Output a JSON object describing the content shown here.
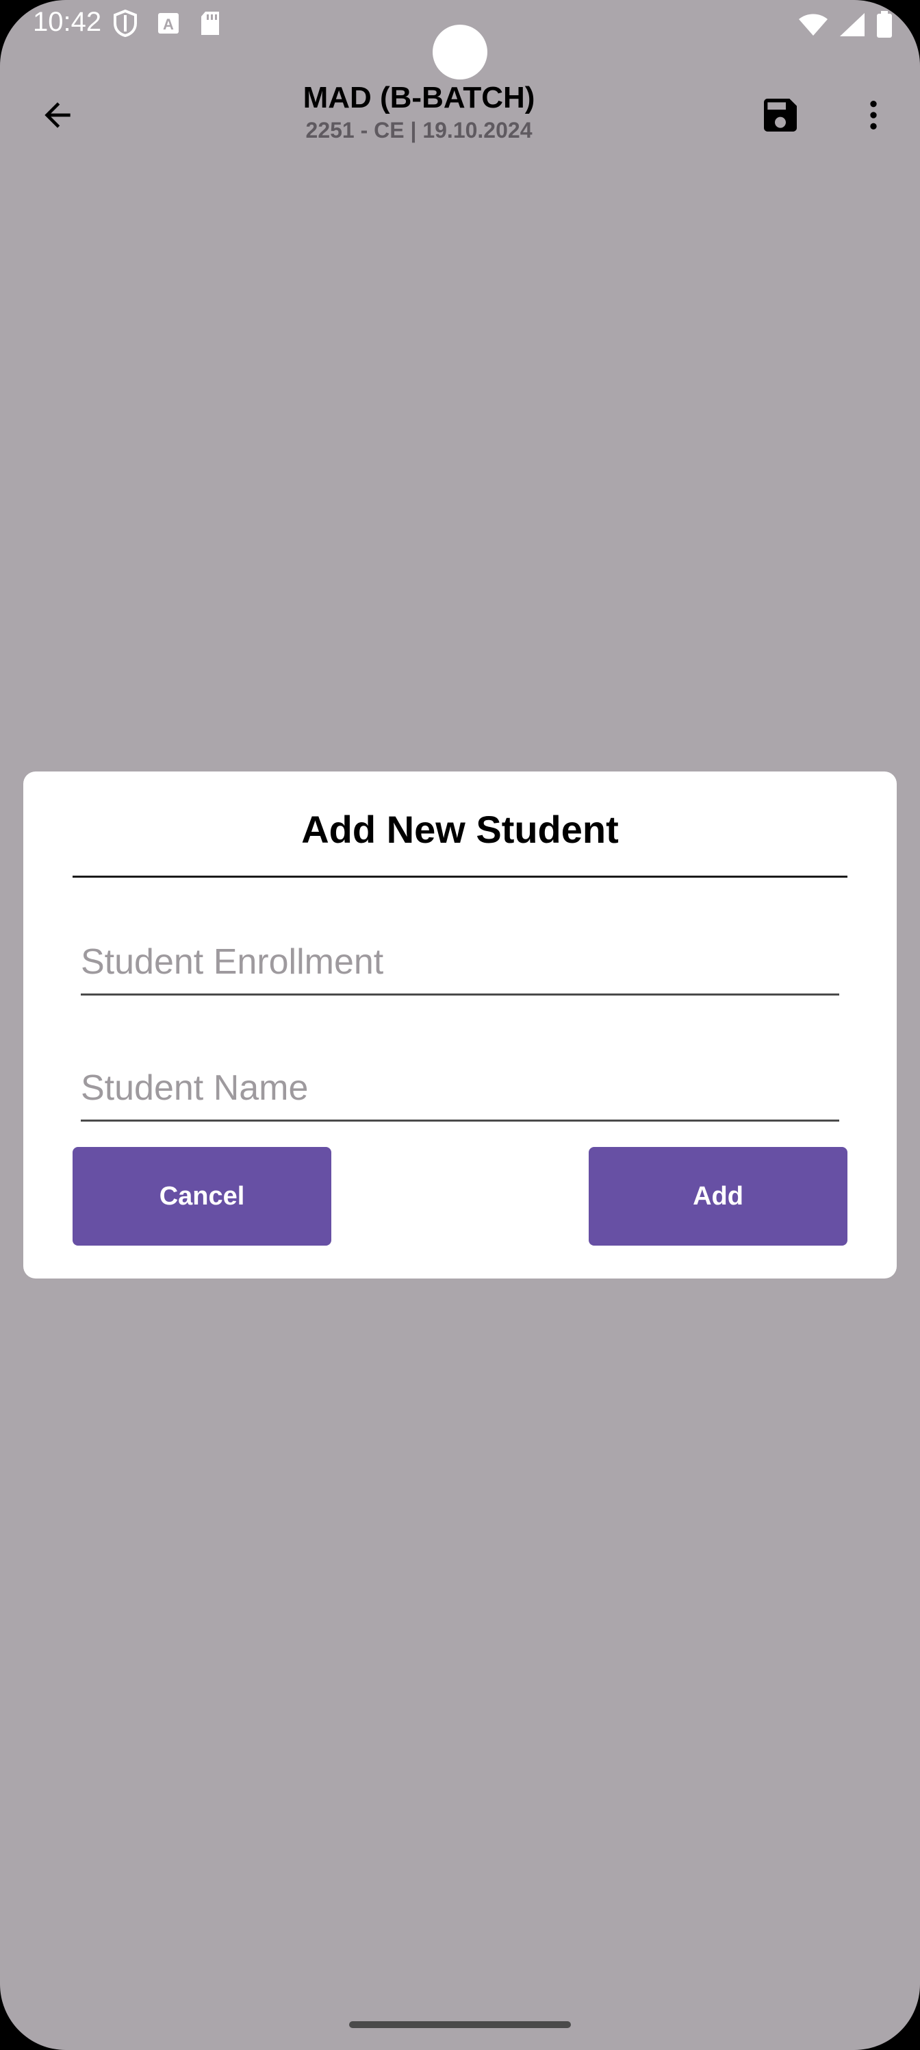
{
  "status_bar": {
    "time": "10:42",
    "left_icons": [
      "shield-icon",
      "font-a-icon",
      "sd-card-icon"
    ],
    "right_icons": [
      "wifi-icon",
      "signal-icon",
      "battery-icon"
    ]
  },
  "app_bar": {
    "title": "MAD (B-BATCH)",
    "subtitle": "2251 - CE | 19.10.2024"
  },
  "dialog": {
    "title": "Add New Student",
    "enrollment_placeholder": "Student Enrollment",
    "name_placeholder": "Student Name",
    "cancel_label": "Cancel",
    "add_label": "Add"
  },
  "colors": {
    "scrim_background": "#aba6ab",
    "button_primary": "#6750a4",
    "dialog_background": "#ffffff"
  }
}
